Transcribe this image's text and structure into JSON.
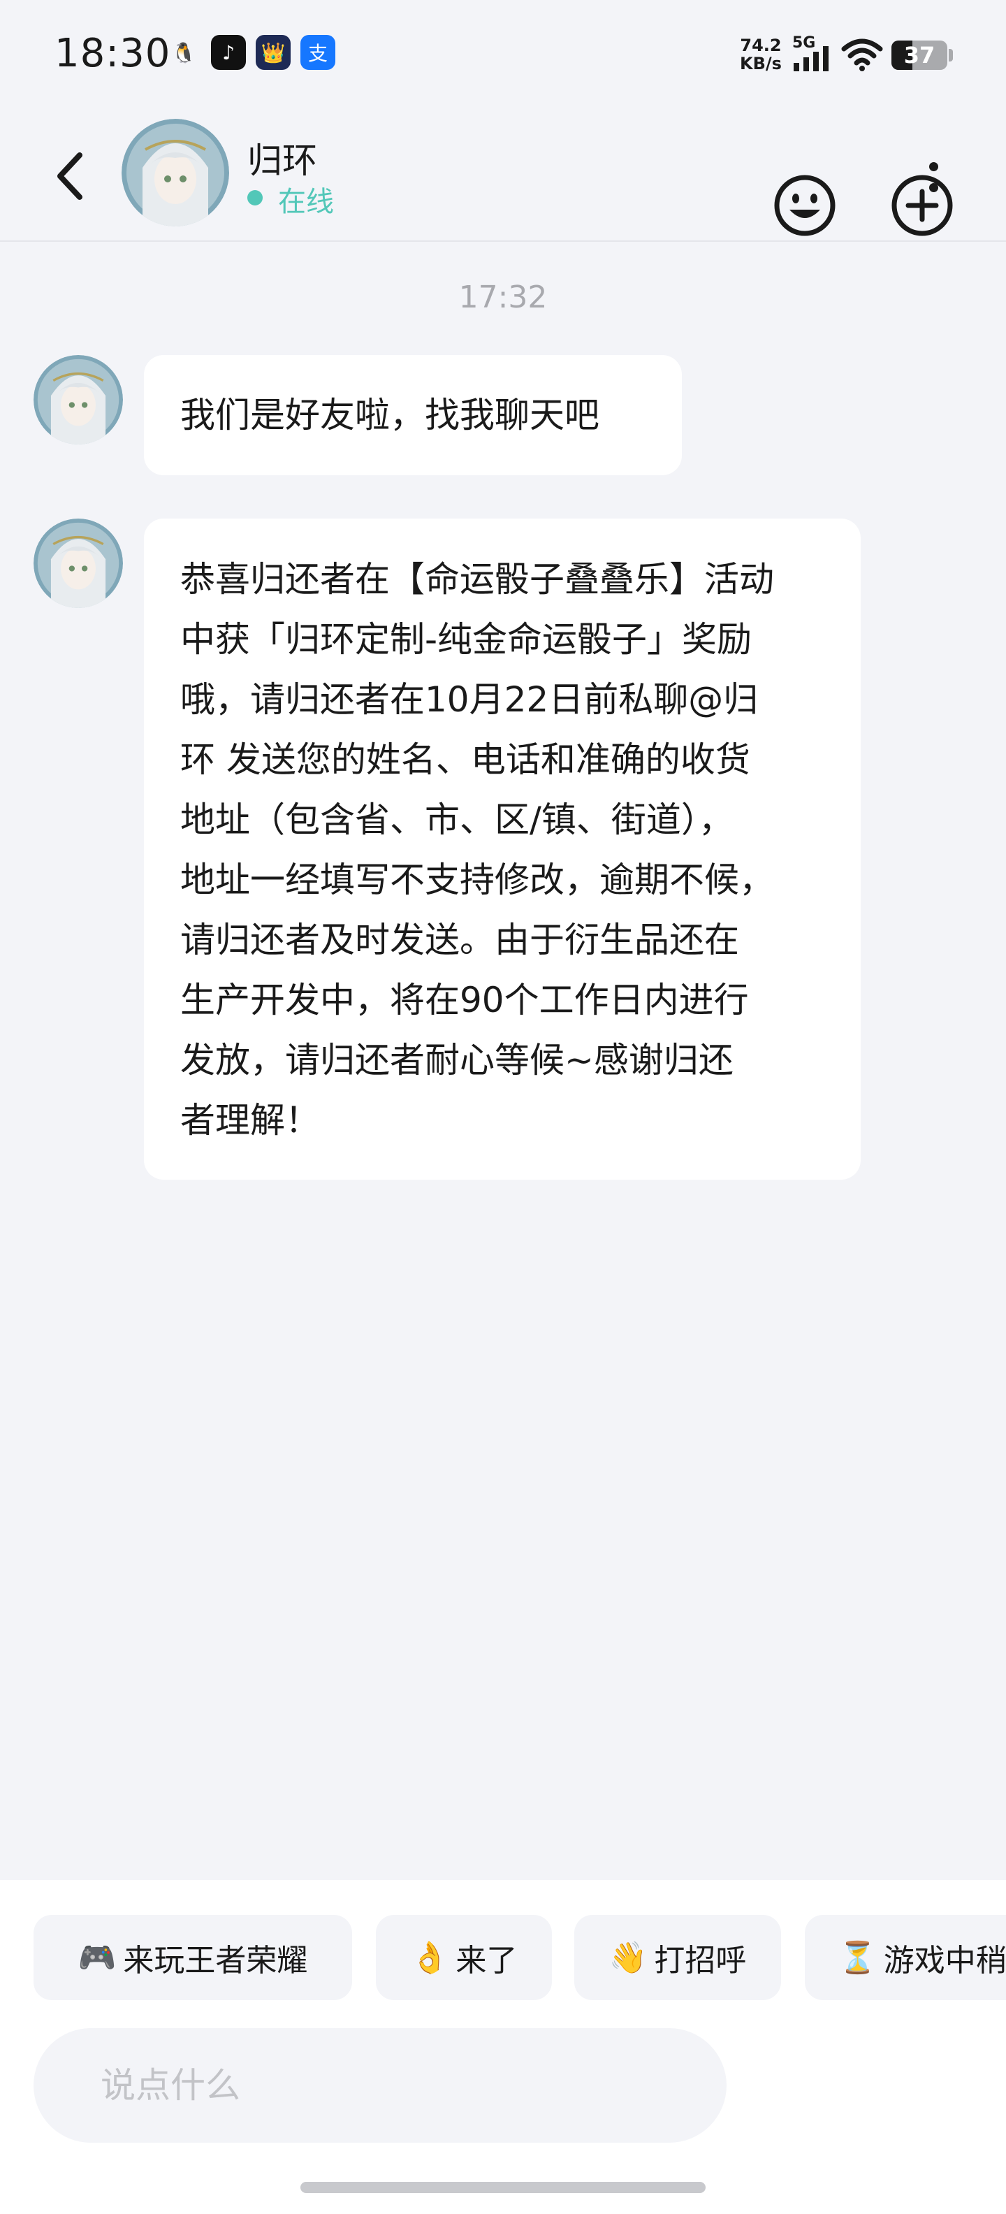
{
  "status_bar": {
    "time": "18:30",
    "apps": [
      {
        "icon": "qq-icon",
        "glyph": "🐧"
      },
      {
        "icon": "tiktok-icon",
        "glyph": "♪"
      },
      {
        "icon": "kpl-icon",
        "glyph": "👑"
      },
      {
        "icon": "alipay-icon",
        "glyph": "支"
      }
    ],
    "network_speed_value": "74.2",
    "network_speed_unit": "KB/s",
    "network_type": "5G",
    "battery_level": "37"
  },
  "header": {
    "back_icon": "chevron-left-icon",
    "contact_name": "归环",
    "status_text": "在线",
    "status_color": "#52c7b8",
    "more_icon": "more-vertical-icon"
  },
  "chat": {
    "timestamp": "17:32",
    "messages": [
      {
        "sender": "归环",
        "lines": [
          "我们是好友啦，找我聊天吧"
        ]
      },
      {
        "sender": "归环",
        "lines": [
          "恭喜归还者在【命运骰子叠叠乐】活动",
          "中获「归环定制-纯金命运骰子」奖励",
          "哦，请归还者在10月22日前私聊@归",
          "环 发送您的姓名、电话和准确的收货",
          "地址（包含省、市、区/镇、街道），",
          "地址一经填写不支持修改，逾期不候，",
          "请归还者及时发送。由于衍生品还在",
          "生产开发中，将在90个工作日内进行",
          "发放，请归还者耐心等候~感谢归还",
          "者理解！"
        ]
      }
    ]
  },
  "quick_replies": [
    {
      "emoji": "🎮",
      "label": "来玩王者荣耀",
      "icon": "gamepad-icon"
    },
    {
      "emoji": "👌",
      "label": "来了",
      "icon": "ok-hand-icon"
    },
    {
      "emoji": "👋",
      "label": "打招呼",
      "icon": "waving-hand-icon"
    },
    {
      "emoji": "⏳",
      "label": "游戏中稍",
      "icon": "hourglass-icon"
    }
  ],
  "composer": {
    "placeholder": "说点什么",
    "value": "",
    "emoji_icon": "smiley-icon",
    "plus_icon": "plus-circle-icon"
  }
}
